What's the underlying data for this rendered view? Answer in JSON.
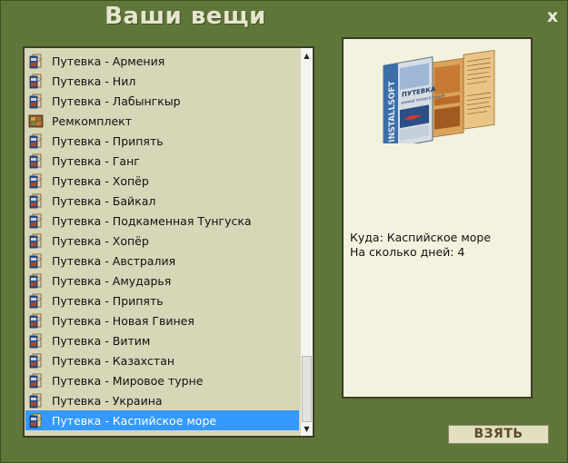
{
  "window": {
    "title": "Ваши вещи",
    "close_label": "x"
  },
  "items": [
    {
      "label": "Путевка - Армения",
      "icon": "voucher-icon"
    },
    {
      "label": "Путевка - Нил",
      "icon": "voucher-icon"
    },
    {
      "label": "Путевка - Лабынгкыр",
      "icon": "voucher-icon"
    },
    {
      "label": "Ремкомплект",
      "icon": "repair-kit-icon"
    },
    {
      "label": "Путевка - Припять",
      "icon": "voucher-icon"
    },
    {
      "label": "Путевка - Ганг",
      "icon": "voucher-icon"
    },
    {
      "label": "Путевка - Хопёр",
      "icon": "voucher-icon"
    },
    {
      "label": "Путевка - Байкал",
      "icon": "voucher-icon"
    },
    {
      "label": "Путевка - Подкаменная Тунгуска",
      "icon": "voucher-icon"
    },
    {
      "label": "Путевка - Хопёр",
      "icon": "voucher-icon"
    },
    {
      "label": "Путевка - Австралия",
      "icon": "voucher-icon"
    },
    {
      "label": "Путевка - Амударья",
      "icon": "voucher-icon"
    },
    {
      "label": "Путевка - Припять",
      "icon": "voucher-icon"
    },
    {
      "label": "Путевка - Новая Гвинея",
      "icon": "voucher-icon"
    },
    {
      "label": "Путевка - Витим",
      "icon": "voucher-icon"
    },
    {
      "label": "Путевка - Казахстан",
      "icon": "voucher-icon"
    },
    {
      "label": "Путевка - Мировое турне",
      "icon": "voucher-icon"
    },
    {
      "label": "Путевка - Украина",
      "icon": "voucher-icon"
    },
    {
      "label": "Путевка - Каспийское море",
      "icon": "voucher-icon",
      "selected": true
    }
  ],
  "details": {
    "image": "voucher-brochure-image",
    "brochure_brand": "INSTALLSOFT",
    "brochure_title": "ПУТЕВКА",
    "brochure_subtitle": "ЗИМНИЙ ТУРИЗМ В ГРЕЦИИ",
    "destination_text": "Куда: Каспийское море",
    "days_text": "На сколько дней: 4"
  },
  "buttons": {
    "take_label": "ВЗЯТЬ"
  },
  "colors": {
    "background": "#5e7637",
    "selection": "#3399ff",
    "list_background": "#d7d6b7",
    "panel_background": "#f3f2df"
  }
}
